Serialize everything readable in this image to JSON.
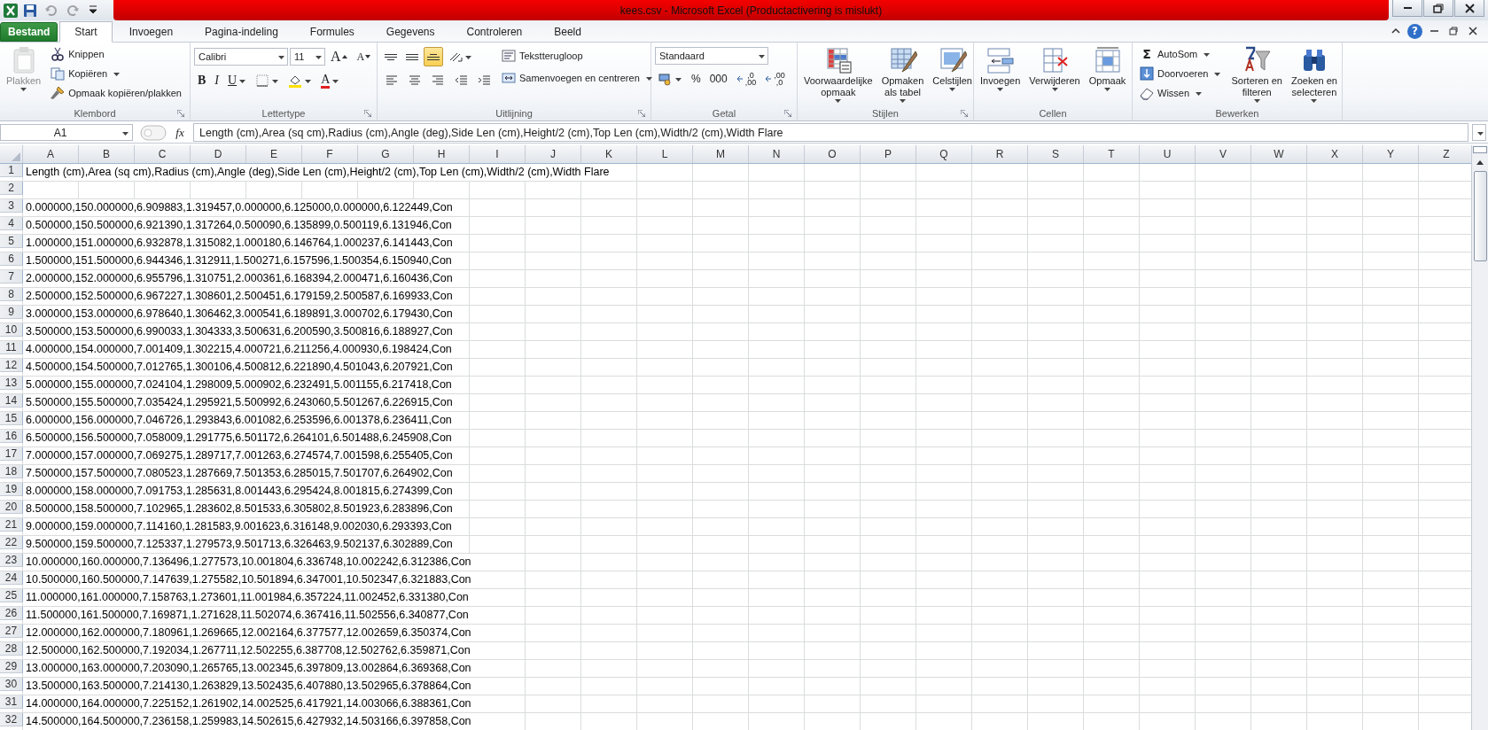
{
  "title_bar": {
    "title": "kees.csv - Microsoft Excel (Productactivering is mislukt)",
    "quick_access": [
      {
        "disabled": false
      },
      {
        "disabled": true
      },
      {
        "disabled": true
      },
      {
        "disabled": false
      }
    ]
  },
  "tabs": [
    {
      "label": "Bestand",
      "kind": "file",
      "selected": false
    },
    {
      "label": "Start",
      "kind": "tab",
      "selected": true
    },
    {
      "label": "Invoegen",
      "kind": "tab",
      "selected": false
    },
    {
      "label": "Pagina-indeling",
      "kind": "tab",
      "selected": false
    },
    {
      "label": "Formules",
      "kind": "tab",
      "selected": false
    },
    {
      "label": "Gegevens",
      "kind": "tab",
      "selected": false
    },
    {
      "label": "Controleren",
      "kind": "tab",
      "selected": false
    },
    {
      "label": "Beeld",
      "kind": "tab",
      "selected": false
    }
  ],
  "help_label": "?",
  "ribbon": [
    {
      "label": "Klembord",
      "launcher": true,
      "blocks": [
        {
          "kind": "large",
          "lines": [
            "Plakken"
          ],
          "dropdown": true,
          "disabled": true
        },
        {
          "kind": "stack",
          "rows": [
            {
              "items": [
                {
                  "kind": "small",
                  "label": "Knippen",
                  "dropdown": false
                }
              ]
            },
            {
              "items": [
                {
                  "kind": "small",
                  "label": "Kopiëren",
                  "dropdown": true
                }
              ]
            },
            {
              "items": [
                {
                  "kind": "small",
                  "label": "Opmaak kopiëren/plakken",
                  "dropdown": false
                }
              ]
            }
          ]
        }
      ]
    },
    {
      "label": "Lettertype",
      "launcher": true,
      "blocks": [
        {
          "kind": "stack",
          "rows": [
            {
              "items": [
                {
                  "kind": "combo",
                  "value": "Calibri",
                  "wide": true
                },
                {
                  "kind": "combo",
                  "value": "11",
                  "wide": false
                },
                {
                  "kind": "grow",
                  "label": "A",
                  "dropdown": false
                },
                {
                  "kind": "shrink",
                  "label": "A",
                  "dropdown": false
                }
              ]
            },
            {
              "items": [
                {
                  "kind": "bold",
                  "label": "B",
                  "dropdown": false
                },
                {
                  "kind": "italic",
                  "label": "I",
                  "dropdown": false
                },
                {
                  "kind": "underline",
                  "label": "U",
                  "dropdown": true
                },
                {
                  "kind": "tool",
                  "dropdown": true,
                  "selected": false
                },
                {
                  "kind": "tool",
                  "dropdown": true,
                  "selected": false
                },
                {
                  "kind": "fontcolor",
                  "label": "A",
                  "dropdown": true
                }
              ]
            }
          ]
        }
      ]
    },
    {
      "label": "Uitlijning",
      "launcher": true,
      "blocks": [
        {
          "kind": "stack",
          "rows": [
            {
              "items": [
                {
                  "kind": "tool",
                  "dropdown": false,
                  "selected": false
                },
                {
                  "kind": "tool",
                  "dropdown": false,
                  "selected": false
                },
                {
                  "kind": "tool",
                  "dropdown": false,
                  "selected": true
                },
                {
                  "kind": "tool",
                  "dropdown": true,
                  "selected": false
                }
              ]
            },
            {
              "items": [
                {
                  "kind": "tool",
                  "dropdown": false,
                  "selected": false
                },
                {
                  "kind": "tool",
                  "dropdown": false,
                  "selected": false
                },
                {
                  "kind": "tool",
                  "dropdown": false,
                  "selected": false
                },
                {
                  "kind": "tool",
                  "dropdown": false,
                  "selected": false
                },
                {
                  "kind": "tool",
                  "dropdown": false,
                  "selected": false
                }
              ]
            }
          ]
        },
        {
          "kind": "stack",
          "rows": [
            {
              "items": [
                {
                  "kind": "small",
                  "label": "Tekstterugloop",
                  "dropdown": false
                }
              ]
            },
            {
              "items": [
                {
                  "kind": "small",
                  "label": "Samenvoegen en centreren",
                  "dropdown": true
                }
              ]
            }
          ]
        }
      ]
    },
    {
      "label": "Getal",
      "launcher": true,
      "blocks": [
        {
          "kind": "stack",
          "rows": [
            {
              "items": [
                {
                  "kind": "combo",
                  "value": "Standaard",
                  "wide": true
                }
              ]
            },
            {
              "items": [
                {
                  "kind": "tool",
                  "dropdown": true,
                  "selected": false
                },
                {
                  "kind": "text",
                  "label": "%",
                  "dropdown": false
                },
                {
                  "kind": "text",
                  "label": "000",
                  "dropdown": false
                },
                {
                  "kind": "decimal",
                  "lines": [
                    ",0",
                    ",00"
                  ]
                },
                {
                  "kind": "decimal",
                  "lines": [
                    ",00",
                    ",0"
                  ]
                }
              ]
            }
          ]
        }
      ]
    },
    {
      "label": "Stijlen",
      "launcher": true,
      "blocks": [
        {
          "kind": "large",
          "lines": [
            "Voorwaardelijke",
            "opmaak"
          ],
          "dropdown": true,
          "disabled": false
        },
        {
          "kind": "large",
          "lines": [
            "Opmaken",
            "als tabel"
          ],
          "dropdown": true,
          "disabled": false
        },
        {
          "kind": "large",
          "lines": [
            "Celstijlen"
          ],
          "dropdown": true,
          "disabled": false
        }
      ]
    },
    {
      "label": "Cellen",
      "launcher": false,
      "blocks": [
        {
          "kind": "large",
          "lines": [
            "Invoegen"
          ],
          "dropdown": true,
          "disabled": false
        },
        {
          "kind": "large",
          "lines": [
            "Verwijderen"
          ],
          "dropdown": true,
          "disabled": false
        },
        {
          "kind": "large",
          "lines": [
            "Opmaak"
          ],
          "dropdown": true,
          "disabled": false
        }
      ]
    },
    {
      "label": "Bewerken",
      "launcher": false,
      "blocks": [
        {
          "kind": "stack",
          "rows": [
            {
              "items": [
                {
                  "kind": "sigma",
                  "glyph": "Σ",
                  "label": "AutoSom",
                  "dropdown": true
                }
              ]
            },
            {
              "items": [
                {
                  "kind": "small",
                  "label": "Doorvoeren",
                  "dropdown": true
                }
              ]
            },
            {
              "items": [
                {
                  "kind": "small",
                  "label": "Wissen",
                  "dropdown": true
                }
              ]
            }
          ]
        },
        {
          "kind": "large",
          "lines": [
            "Sorteren en",
            "filteren"
          ],
          "dropdown": true,
          "disabled": false
        },
        {
          "kind": "large",
          "lines": [
            "Zoeken en",
            "selecteren"
          ],
          "dropdown": true,
          "disabled": false
        }
      ]
    }
  ],
  "formula_bar": {
    "name_box": "A1",
    "fx": "fx",
    "formula": "Length (cm),Area (sq cm),Radius (cm),Angle (deg),Side Len (cm),Height/2 (cm),Top Len (cm),Width/2 (cm),Width Flare"
  },
  "sheet": {
    "columns": [
      "A",
      "B",
      "C",
      "D",
      "E",
      "F",
      "G",
      "H",
      "I",
      "J",
      "K",
      "L",
      "M",
      "N",
      "O",
      "P",
      "Q",
      "R",
      "S",
      "T",
      "U",
      "V",
      "W",
      "X",
      "Y",
      "Z"
    ],
    "rows": [
      {
        "number": "1",
        "text": "Length (cm),Area (sq cm),Radius (cm),Angle (deg),Side Len (cm),Height/2 (cm),Top Len (cm),Width/2 (cm),Width Flare"
      },
      {
        "number": "2"
      },
      {
        "number": "3",
        "text": "0.000000,150.000000,6.909883,1.319457,0.000000,6.125000,0.000000,6.122449,Con"
      },
      {
        "number": "4",
        "text": "0.500000,150.500000,6.921390,1.317264,0.500090,6.135899,0.500119,6.131946,Con"
      },
      {
        "number": "5",
        "text": "1.000000,151.000000,6.932878,1.315082,1.000180,6.146764,1.000237,6.141443,Con"
      },
      {
        "number": "6",
        "text": "1.500000,151.500000,6.944346,1.312911,1.500271,6.157596,1.500354,6.150940,Con"
      },
      {
        "number": "7",
        "text": "2.000000,152.000000,6.955796,1.310751,2.000361,6.168394,2.000471,6.160436,Con"
      },
      {
        "number": "8",
        "text": "2.500000,152.500000,6.967227,1.308601,2.500451,6.179159,2.500587,6.169933,Con"
      },
      {
        "number": "9",
        "text": "3.000000,153.000000,6.978640,1.306462,3.000541,6.189891,3.000702,6.179430,Con"
      },
      {
        "number": "10",
        "text": "3.500000,153.500000,6.990033,1.304333,3.500631,6.200590,3.500816,6.188927,Con"
      },
      {
        "number": "11",
        "text": "4.000000,154.000000,7.001409,1.302215,4.000721,6.211256,4.000930,6.198424,Con"
      },
      {
        "number": "12",
        "text": "4.500000,154.500000,7.012765,1.300106,4.500812,6.221890,4.501043,6.207921,Con"
      },
      {
        "number": "13",
        "text": "5.000000,155.000000,7.024104,1.298009,5.000902,6.232491,5.001155,6.217418,Con"
      },
      {
        "number": "14",
        "text": "5.500000,155.500000,7.035424,1.295921,5.500992,6.243060,5.501267,6.226915,Con"
      },
      {
        "number": "15",
        "text": "6.000000,156.000000,7.046726,1.293843,6.001082,6.253596,6.001378,6.236411,Con"
      },
      {
        "number": "16",
        "text": "6.500000,156.500000,7.058009,1.291775,6.501172,6.264101,6.501488,6.245908,Con"
      },
      {
        "number": "17",
        "text": "7.000000,157.000000,7.069275,1.289717,7.001263,6.274574,7.001598,6.255405,Con"
      },
      {
        "number": "18",
        "text": "7.500000,157.500000,7.080523,1.287669,7.501353,6.285015,7.501707,6.264902,Con"
      },
      {
        "number": "19",
        "text": "8.000000,158.000000,7.091753,1.285631,8.001443,6.295424,8.001815,6.274399,Con"
      },
      {
        "number": "20",
        "text": "8.500000,158.500000,7.102965,1.283602,8.501533,6.305802,8.501923,6.283896,Con"
      },
      {
        "number": "21",
        "text": "9.000000,159.000000,7.114160,1.281583,9.001623,6.316148,9.002030,6.293393,Con"
      },
      {
        "number": "22",
        "text": "9.500000,159.500000,7.125337,1.279573,9.501713,6.326463,9.502137,6.302889,Con"
      },
      {
        "number": "23",
        "text": "10.000000,160.000000,7.136496,1.277573,10.001804,6.336748,10.002242,6.312386,Con"
      },
      {
        "number": "24",
        "text": "10.500000,160.500000,7.147639,1.275582,10.501894,6.347001,10.502347,6.321883,Con"
      },
      {
        "number": "25",
        "text": "11.000000,161.000000,7.158763,1.273601,11.001984,6.357224,11.002452,6.331380,Con"
      },
      {
        "number": "26",
        "text": "11.500000,161.500000,7.169871,1.271628,11.502074,6.367416,11.502556,6.340877,Con"
      },
      {
        "number": "27",
        "text": "12.000000,162.000000,7.180961,1.269665,12.002164,6.377577,12.002659,6.350374,Con"
      },
      {
        "number": "28",
        "text": "12.500000,162.500000,7.192034,1.267711,12.502255,6.387708,12.502762,6.359871,Con"
      },
      {
        "number": "29",
        "text": "13.000000,163.000000,7.203090,1.265765,13.002345,6.397809,13.002864,6.369368,Con"
      },
      {
        "number": "30",
        "text": "13.500000,163.500000,7.214130,1.263829,13.502435,6.407880,13.502965,6.378864,Con"
      },
      {
        "number": "31",
        "text": "14.000000,164.000000,7.225152,1.261902,14.002525,6.417921,14.003066,6.388361,Con"
      },
      {
        "number": "32",
        "text": "14.500000,164.500000,7.236158,1.259983,14.502615,6.427932,14.503166,6.397858,Con"
      }
    ]
  }
}
